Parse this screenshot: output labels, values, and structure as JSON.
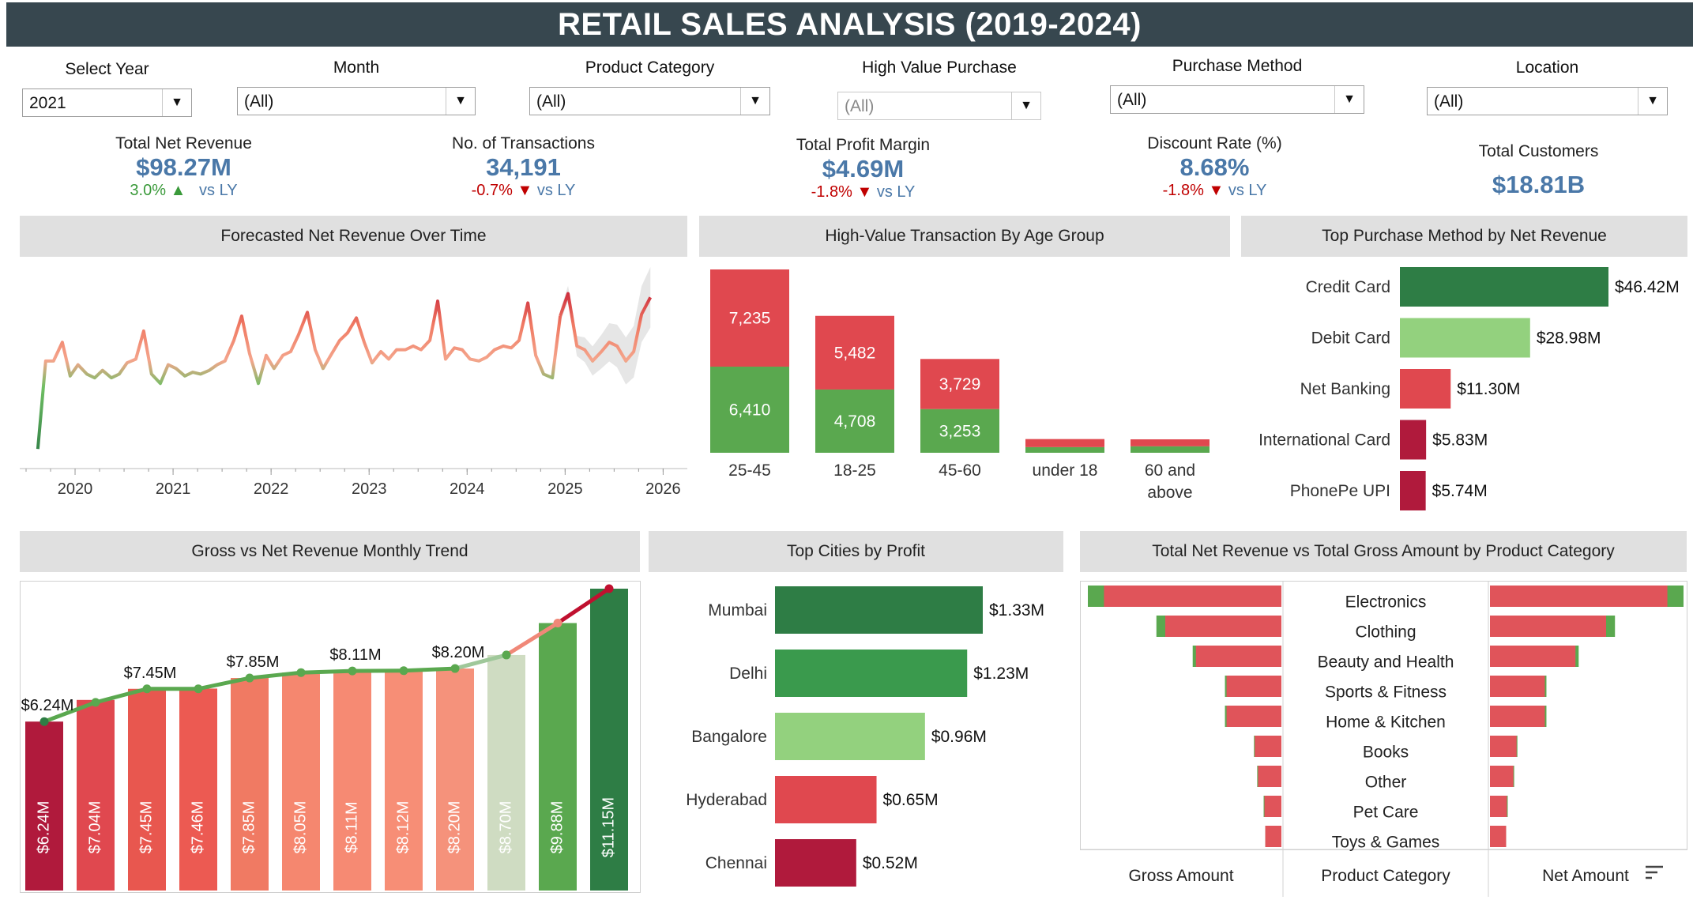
{
  "title": "RETAIL SALES ANALYSIS (2019-2024)",
  "filters": [
    {
      "label": "Select Year",
      "value": "2021"
    },
    {
      "label": "Month",
      "value": "(All)"
    },
    {
      "label": "Product Category",
      "value": "(All)"
    },
    {
      "label": "High Value Purchase",
      "value": "(All)"
    },
    {
      "label": "Purchase Method",
      "value": "(All)"
    },
    {
      "label": "Location",
      "value": "(All)"
    }
  ],
  "kpis": [
    {
      "label": "Total Net Revenue",
      "value": "$98.27M",
      "delta": "3.0%",
      "direction": "up",
      "arrow": "▲",
      "vs": "vs LY"
    },
    {
      "label": "No. of Transactions",
      "value": "34,191",
      "delta": "-0.7%",
      "direction": "down",
      "arrow": "▼",
      "vs": "vs LY"
    },
    {
      "label": "Total Profit Margin",
      "value": "$4.69M",
      "delta": "-1.8%",
      "direction": "down",
      "arrow": "▼",
      "vs": "vs LY"
    },
    {
      "label": "Discount Rate (%)",
      "value": "8.68%",
      "delta": "-1.8%",
      "direction": "down",
      "arrow": "▼",
      "vs": "vs LY"
    },
    {
      "label": "Total Customers",
      "value": "$18.81B"
    }
  ],
  "panels": {
    "forecast": "Forecasted Net Revenue Over Time",
    "age": "High-Value Transaction By Age Group",
    "method": "Top Purchase Method by Net Revenue",
    "trend": "Gross vs Net Revenue Monthly Trend",
    "cities": "Top Cities by Profit",
    "category": "Total Net Revenue vs Total Gross Amount by Product Category"
  },
  "colors": {
    "dark_green": "#2e7d45",
    "green": "#5aa84f",
    "light_green": "#93d17e",
    "red": "#e0484f",
    "dark_red": "#b01a3c",
    "salmon": "#f08878",
    "header_gray": "#e0e0e0",
    "title_bar": "#37474f",
    "kpi_blue": "#4a78a8"
  },
  "chart_data": [
    {
      "id": "forecast",
      "type": "line",
      "x_ticks": [
        "2020",
        "2021",
        "2022",
        "2023",
        "2024",
        "2025",
        "2026"
      ],
      "x": [
        2019.62,
        2019.7,
        2019.78,
        2019.87,
        2019.95,
        2020.03,
        2020.12,
        2020.2,
        2020.28,
        2020.37,
        2020.45,
        2020.53,
        2020.62,
        2020.7,
        2020.78,
        2020.87,
        2020.95,
        2021.03,
        2021.12,
        2021.2,
        2021.28,
        2021.37,
        2021.45,
        2021.53,
        2021.62,
        2021.7,
        2021.78,
        2021.87,
        2021.95,
        2022.03,
        2022.12,
        2022.2,
        2022.28,
        2022.37,
        2022.45,
        2022.53,
        2022.62,
        2022.7,
        2022.78,
        2022.87,
        2022.95,
        2023.03,
        2023.12,
        2023.2,
        2023.28,
        2023.37,
        2023.45,
        2023.53,
        2023.62,
        2023.7,
        2023.78,
        2023.87,
        2023.95,
        2024.03,
        2024.12,
        2024.2,
        2024.28,
        2024.37,
        2024.45,
        2024.53,
        2024.62,
        2024.7,
        2024.78,
        2024.87,
        2024.95
      ],
      "y": [
        1.5,
        6.2,
        6.2,
        7.2,
        5.4,
        6.0,
        5.5,
        5.3,
        5.7,
        5.3,
        5.5,
        6.1,
        6.3,
        7.8,
        5.5,
        5.0,
        6.0,
        5.8,
        5.4,
        5.6,
        5.5,
        5.7,
        6.0,
        6.2,
        7.3,
        8.6,
        6.6,
        5.0,
        6.5,
        5.8,
        6.5,
        6.7,
        7.6,
        8.8,
        6.8,
        5.8,
        6.6,
        7.3,
        7.7,
        8.5,
        7.2,
        6.1,
        6.7,
        6.3,
        6.8,
        6.8,
        7.0,
        6.8,
        7.3,
        9.4,
        6.3,
        6.9,
        6.8,
        6.3,
        6.2,
        6.4,
        6.8,
        7.0,
        6.9,
        7.3,
        9.3,
        6.5,
        5.5,
        5.3,
        8.6
      ],
      "forecast_x": [
        2024.95,
        2025.03,
        2025.12,
        2025.2,
        2025.28,
        2025.37,
        2025.45,
        2025.53,
        2025.62,
        2025.7,
        2025.78,
        2025.87
      ],
      "forecast_y": [
        8.6,
        9.8,
        7.0,
        6.8,
        6.2,
        6.7,
        7.2,
        7.0,
        6.2,
        6.7,
        8.7,
        9.6
      ],
      "ylim": [
        1,
        10.5
      ],
      "grid": false
    },
    {
      "id": "age",
      "type": "bar",
      "stacked": true,
      "categories": [
        "25-45",
        "18-25",
        "45-60",
        "under 18",
        "60 and above"
      ],
      "series": [
        {
          "values": [
            6410,
            4708,
            3253,
            420,
            480
          ],
          "color": "#5aa84f"
        },
        {
          "values": [
            7235,
            5482,
            3729,
            600,
            520
          ],
          "color": "#e0484f"
        }
      ],
      "data_labels": [
        [
          "6,410",
          "4,708",
          "3,253",
          "",
          ""
        ],
        [
          "7,235",
          "5,482",
          "3,729",
          "",
          ""
        ]
      ]
    },
    {
      "id": "method",
      "type": "bar",
      "orientation": "horizontal",
      "categories": [
        "Credit Card",
        "Debit Card",
        "Net Banking",
        "International Card",
        "PhonePe UPI"
      ],
      "values": [
        46.42,
        28.98,
        11.3,
        5.83,
        5.74
      ],
      "labels": [
        "$46.42M",
        "$28.98M",
        "$11.30M",
        "$5.83M",
        "$5.74M"
      ],
      "colors": [
        "#2e7d45",
        "#93d17e",
        "#e0484f",
        "#b01a3c",
        "#b01a3c"
      ]
    },
    {
      "id": "trend",
      "type": "bar",
      "values": [
        6.24,
        7.04,
        7.45,
        7.46,
        7.85,
        8.05,
        8.11,
        8.12,
        8.2,
        8.7,
        9.88,
        11.15
      ],
      "bar_labels": [
        "$6.24M",
        "$7.04M",
        "$7.45M",
        "$7.46M",
        "$7.85M",
        "$8.05M",
        "$8.11M",
        "$8.12M",
        "$8.20M",
        "$8.70M",
        "$9.88M",
        "$11.15M"
      ],
      "bar_colors": [
        "#b01a3c",
        "#e0484f",
        "#e8574f",
        "#ec5a52",
        "#f07a63",
        "#f5876f",
        "#f68a73",
        "#f78e76",
        "#f5927b",
        "#cfdcc2",
        "#5aa84f",
        "#2e7d45"
      ],
      "line_values": [
        6.24,
        6.95,
        7.45,
        7.45,
        7.85,
        8.05,
        8.11,
        8.12,
        8.2,
        8.7,
        9.88,
        11.15
      ],
      "line_labels": [
        "$6.24M",
        "",
        "$7.45M",
        "",
        "$7.85M",
        "",
        "$8.11M",
        "",
        "$8.20M",
        "",
        "",
        "$11.15M"
      ],
      "ylim": [
        0,
        11.5
      ]
    },
    {
      "id": "cities",
      "type": "bar",
      "orientation": "horizontal",
      "categories": [
        "Mumbai",
        "Delhi",
        "Bangalore",
        "Hyderabad",
        "Chennai"
      ],
      "values": [
        1.33,
        1.23,
        0.96,
        0.65,
        0.52
      ],
      "labels": [
        "$1.33M",
        "$1.23M",
        "$0.96M",
        "$0.65M",
        "$0.52M"
      ],
      "colors": [
        "#2e7d45",
        "#3a9a4d",
        "#93d17e",
        "#e0484f",
        "#b01a3c"
      ]
    },
    {
      "id": "category",
      "type": "bar",
      "orientation": "horizontal",
      "categories": [
        "Electronics",
        "Clothing",
        "Beauty and Health",
        "Sports & Fitness",
        "Home & Kitchen",
        "Books",
        "Other",
        "Pet Care",
        "Toys & Games"
      ],
      "gross": [
        24.0,
        15.5,
        11.0,
        7.0,
        7.0,
        3.4,
        3.0,
        2.2,
        2.0
      ],
      "net": [
        22.0,
        14.4,
        10.6,
        6.8,
        6.8,
        3.3,
        2.9,
        2.1,
        2.0
      ],
      "column_headers": [
        "Gross Amount",
        "Product Category",
        "Net Amount"
      ]
    }
  ]
}
